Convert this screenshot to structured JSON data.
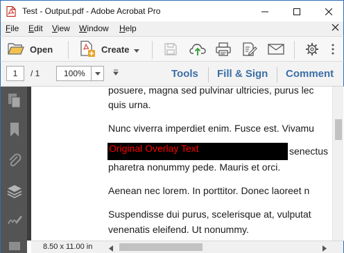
{
  "window": {
    "title": "Test - Output.pdf - Adobe Acrobat Pro"
  },
  "menu": {
    "items": [
      {
        "label": "File",
        "accel": "F",
        "rest": "ile"
      },
      {
        "label": "Edit",
        "accel": "E",
        "rest": "dit"
      },
      {
        "label": "View",
        "accel": "V",
        "rest": "iew"
      },
      {
        "label": "Window",
        "accel": "W",
        "rest": "indow"
      },
      {
        "label": "Help",
        "accel": "H",
        "rest": "elp"
      }
    ],
    "close_glyph": "×"
  },
  "toolbar": {
    "open_label": "Open",
    "create_label": "Create"
  },
  "navbar": {
    "current_page": "1",
    "page_total": "/  1",
    "zoom": "100%",
    "tools_label": "Tools",
    "fill_sign_label": "Fill & Sign",
    "comment_label": "Comment"
  },
  "document": {
    "lines": [
      "posuere, magna sed pulvinar ultricies, purus lec",
      "quis urna.",
      "Nunc viverra imperdiet enim. Fusce est. Vivamu",
      "senectus",
      "pharetra nonummy pede. Mauris et orci.",
      "Aenean nec lorem. In porttitor. Donec laoreet n",
      "Suspendisse dui purus, scelerisque at, vulputat",
      "venenatis eleifend. Ut nonummy."
    ],
    "overlay_text": "Original Overlay Text",
    "overlay_text_color": "#ff0000",
    "overlay_bg_color": "#000000"
  },
  "status": {
    "page_size": "8.50 x 11.00 in"
  },
  "colors": {
    "link_blue": "#3a6ea5",
    "left_panel": "#545454",
    "window_border": "#2f6fb5"
  }
}
